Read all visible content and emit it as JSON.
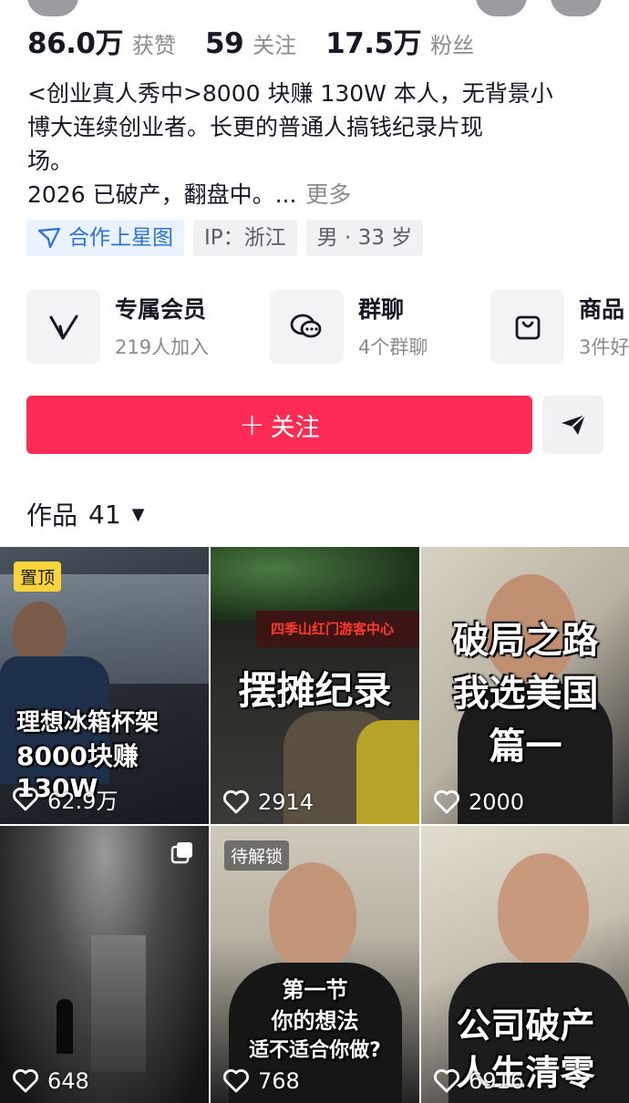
{
  "stats": [
    {
      "number": "86.0万",
      "label": "获赞"
    },
    {
      "number": "59",
      "label": "关注"
    },
    {
      "number": "17.5万",
      "label": "粉丝"
    }
  ],
  "bio": {
    "line1": "<创业真人秀中>8000 块赚 130W 本人，无背景小",
    "line2": "博大连续创业者。长更的普通人搞钱纪录片现",
    "line3": "场。",
    "line4": "2026 已破产，翻盘中。...",
    "more": "更多"
  },
  "tags": {
    "star": "合作上星图",
    "ip": "IP：浙江",
    "gender_age": "男 · 33 岁"
  },
  "features": [
    {
      "icon": "membership-v-icon",
      "title": "专属会员",
      "subtitle": "219人加入"
    },
    {
      "icon": "group-chat-icon",
      "title": "群聊",
      "subtitle": "4个群聊"
    },
    {
      "icon": "shopping-bag-icon",
      "title": "商品",
      "subtitle": "3件好"
    }
  ],
  "follow_button": {
    "plus": "+",
    "label": "关注"
  },
  "works": {
    "label": "作品",
    "count": "41",
    "caret": "▼"
  },
  "videos": [
    {
      "badge": "置顶",
      "caption_line1": "理想冰箱杯架",
      "caption_line2": "8000块赚130W",
      "likes": "62.9万"
    },
    {
      "sign": "四季山红门游客中心",
      "caption_line1": "摆摊纪录",
      "likes": "2914"
    },
    {
      "caption_line1": "破局之路",
      "caption_line2": "我选美国",
      "caption_line3": "篇一",
      "likes": "2000"
    },
    {
      "likes": "648",
      "multi_icon": "multi-image-icon"
    },
    {
      "badge": "待解锁",
      "caption_line1": "第一节",
      "caption_line2": "你的想法",
      "caption_line3": "适不适合你做?",
      "likes": "768"
    },
    {
      "caption_line1": "公司破产",
      "caption_line2": "人生清零",
      "likes": "6916"
    }
  ],
  "colors": {
    "follow": "#fe2c55",
    "star_tag": "#2a73dd",
    "pin_badge": "#fcd33a"
  }
}
